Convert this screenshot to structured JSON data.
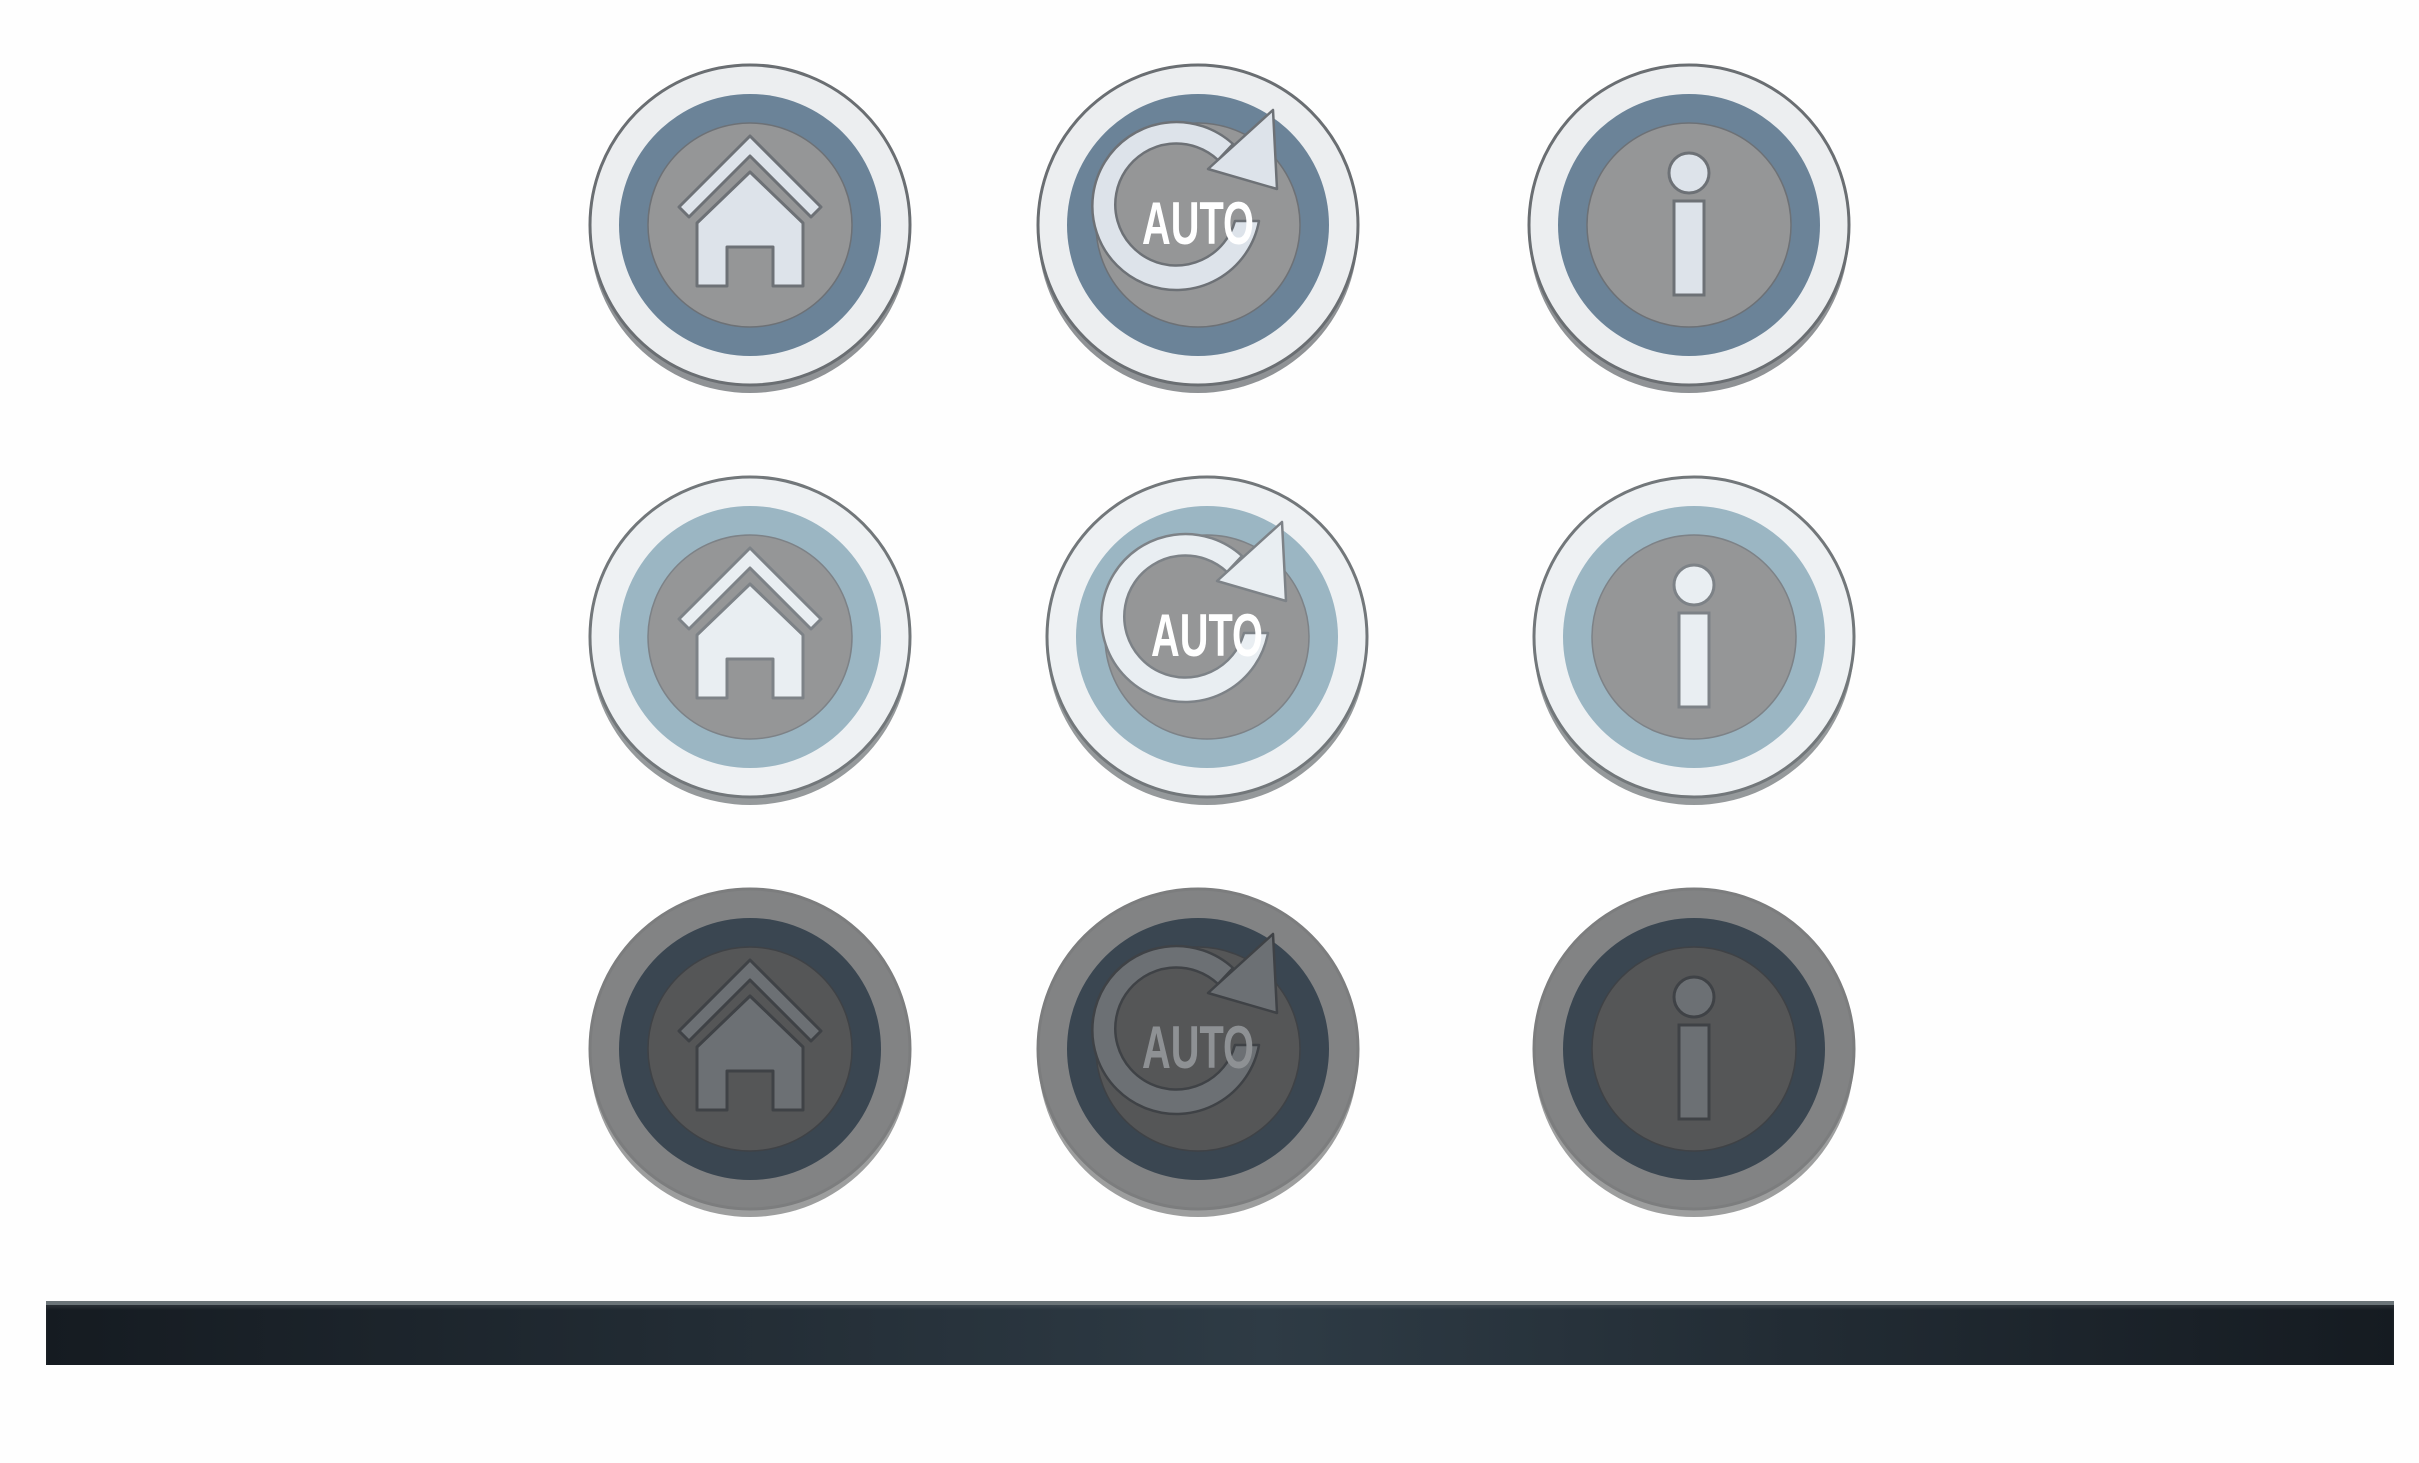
{
  "buttons": {
    "rows": [
      {
        "state": "normal",
        "items": [
          {
            "kind": "home",
            "icon": "home-icon"
          },
          {
            "kind": "auto",
            "icon": "auto-refresh-icon",
            "label": "AUTO"
          },
          {
            "kind": "info",
            "icon": "info-icon"
          }
        ]
      },
      {
        "state": "light",
        "items": [
          {
            "kind": "home",
            "icon": "home-icon"
          },
          {
            "kind": "auto",
            "icon": "auto-refresh-icon",
            "label": "AUTO"
          },
          {
            "kind": "info",
            "icon": "info-icon"
          }
        ]
      },
      {
        "state": "disabled",
        "items": [
          {
            "kind": "home",
            "icon": "home-icon"
          },
          {
            "kind": "auto",
            "icon": "auto-refresh-icon",
            "label": "AUTO"
          },
          {
            "kind": "info",
            "icon": "info-icon"
          }
        ]
      }
    ]
  },
  "themes": {
    "normal": {
      "outer": "#eceef0",
      "outer_edge": "#6a6e72",
      "ring": "#6b8398",
      "center": "#959697",
      "glyph": "#dde3ea",
      "glyph_stroke": "#6d7176",
      "text": "#ffffff"
    },
    "light": {
      "outer": "#eef1f3",
      "outer_edge": "#72777a",
      "ring": "#9bb6c3",
      "center": "#959697",
      "glyph": "#e9eef2",
      "glyph_stroke": "#7d8287",
      "text": "#ffffff"
    },
    "disabled": {
      "outer": "#828384",
      "outer_edge": "#7c7d7e",
      "ring": "#3a4651",
      "center": "#555657",
      "glyph": "#6c7074",
      "glyph_stroke": "#3f4246",
      "text": "#8e9194"
    }
  },
  "bottom_bar": {
    "color_left": "#151b21",
    "color_mid": "#2e3b45",
    "color_right": "#151b21"
  }
}
